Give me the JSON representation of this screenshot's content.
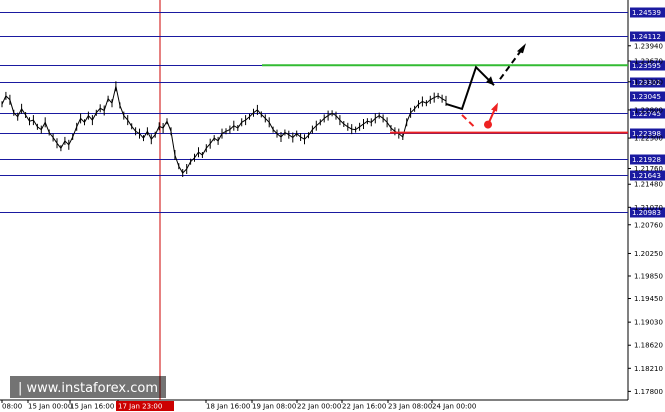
{
  "chart_data": {
    "type": "line",
    "ylim": [
      1.177,
      1.247
    ],
    "y_ticks": [
      1.2394,
      1.2367,
      1.233,
      1.228,
      1.223,
      1.2176,
      1.2148,
      1.2107,
      1.2076,
      1.2025,
      1.1985,
      1.1945,
      1.1903,
      1.1862,
      1.1821,
      1.178
    ],
    "y_tick_labels": [
      "1.23940",
      "1.23670",
      "1.23300",
      "1.22800",
      "1.22300",
      "1.21760",
      "1.21480",
      "1.21070",
      "1.20760",
      "1.20250",
      "1.19850",
      "1.19450",
      "1.19030",
      "1.18620",
      "1.18210",
      "1.17800"
    ],
    "levels": [
      {
        "value": 1.24539,
        "label": "1.24539"
      },
      {
        "value": 1.24112,
        "label": "1.24112"
      },
      {
        "value": 1.23595,
        "label": "1.23595"
      },
      {
        "value": 1.23302,
        "label": "1.23302"
      },
      {
        "value": 1.22745,
        "label": "1.22745"
      },
      {
        "value": 1.22398,
        "label": "1.22398"
      },
      {
        "value": 1.21928,
        "label": "1.21928"
      },
      {
        "value": 1.21643,
        "label": "1.21643"
      },
      {
        "value": 1.20983,
        "label": "1.20983"
      }
    ],
    "current_price": {
      "value": 1.23045,
      "label": "1.23045"
    },
    "x_ticks": [
      "08:00",
      "15 Jan 00:00",
      "15 Jan 16:00",
      "17 Jan 23:00",
      "18 Jan 16:00",
      "19 Jan 08:00",
      "22 Jan 00:00",
      "22 Jan 16:00",
      "23 Jan 08:00",
      "24 Jan 00:00"
    ],
    "highlighted_x_label": "17 Jan 23:00",
    "series": [
      {
        "values": [
          1.229,
          1.2305,
          1.2298,
          1.2275,
          1.2268,
          1.2282,
          1.2271,
          1.226,
          1.2262,
          1.225,
          1.2245,
          1.2258,
          1.224,
          1.2231,
          1.2221,
          1.2212,
          1.2225,
          1.2218,
          1.2232,
          1.225,
          1.2265,
          1.2258,
          1.227,
          1.2262,
          1.2275,
          1.2283,
          1.2279,
          1.23,
          1.2292,
          1.2322,
          1.2288,
          1.227,
          1.2262,
          1.2251,
          1.2242,
          1.2238,
          1.223,
          1.2242,
          1.2228,
          1.2236,
          1.2251,
          1.2248,
          1.226,
          1.2242,
          1.22,
          1.218,
          1.2168,
          1.2175,
          1.2188,
          1.2195,
          1.2205,
          1.22,
          1.2212,
          1.222,
          1.223,
          1.2225,
          1.2238,
          1.2242,
          1.2245,
          1.2252,
          1.2248,
          1.2258,
          1.2262,
          1.2268,
          1.2275,
          1.228,
          1.2272,
          1.2265,
          1.2258,
          1.2245,
          1.2238,
          1.2232,
          1.224,
          1.2236,
          1.2231,
          1.2238,
          1.2232,
          1.2228,
          1.2235,
          1.2245,
          1.2252,
          1.2258,
          1.2265,
          1.227,
          1.2274,
          1.227,
          1.2262,
          1.2255,
          1.225,
          1.2246,
          1.2245,
          1.225,
          1.2255,
          1.226,
          1.2258,
          1.2265,
          1.227,
          1.2265,
          1.2258,
          1.2248,
          1.2242,
          1.2238,
          1.2232,
          1.2258,
          1.2275,
          1.2282,
          1.229,
          1.2295,
          1.2292,
          1.2298,
          1.2302,
          1.2305,
          1.23,
          1.2296
        ]
      }
    ],
    "annotations": {
      "green_level": 1.23595,
      "red_level": 1.22398
    },
    "colors": {
      "price": "#000000",
      "levels": "#1a1aa0",
      "green": "#33bb33",
      "red": "#ee2222",
      "vline": "#cc0000",
      "axis_bg": "#ffffff",
      "level_box": "#1a1aa0",
      "current_box": "#1a1aa0",
      "watermark_bg": "#000000",
      "arrow_black": "#000000",
      "arrow_red": "#ee2222"
    }
  },
  "watermark": {
    "text": "www.instaforex.com"
  }
}
